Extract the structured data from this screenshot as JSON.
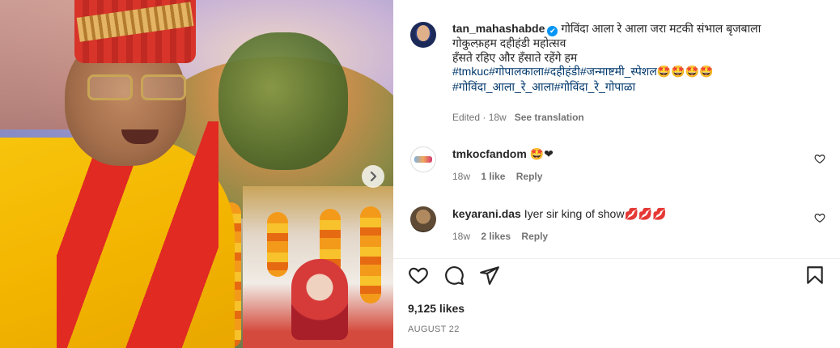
{
  "caption": {
    "username": "tan_mahashabde",
    "line1": "गोविंदा आला रे आला जरा मटकी संभाल बृजबाला",
    "line2": "गोकुल्फ़हम दहीहंडी महोत्सव",
    "line3": "हँसते रहिए और हँसाते रहेंगे हम",
    "hashtags1": "#tmkuc#गोपालकाला#दहीहंडी#जन्माष्टमी_स्पेशल",
    "emojis1": "🤩🤩🤩🤩",
    "hashtags2": "#गोविंदा_आला_रे_आला#गोविंदा_रे_गोपाळा",
    "edited": "Edited · 18w",
    "see_translation": "See translation"
  },
  "comments": [
    {
      "username": "tmkocfandom",
      "text": "🤩❤",
      "time": "18w",
      "likes": "1 like",
      "reply": "Reply"
    },
    {
      "username": "keyarani.das",
      "text": "Iyer sir king of show",
      "emoji": "💋💋💋",
      "time": "18w",
      "likes": "2 likes",
      "reply": "Reply"
    }
  ],
  "post": {
    "likes": "9,125 likes",
    "date": "AUGUST 22"
  },
  "icons": {
    "verified": "verified-badge-icon",
    "next": "chevron-right-icon",
    "like": "heart-icon",
    "comment": "comment-bubble-icon",
    "share": "paper-plane-icon",
    "save": "bookmark-icon"
  },
  "colors": {
    "text": "#262626",
    "secondary": "#737373",
    "hashtag": "#00376b",
    "verified": "#0095f6"
  }
}
